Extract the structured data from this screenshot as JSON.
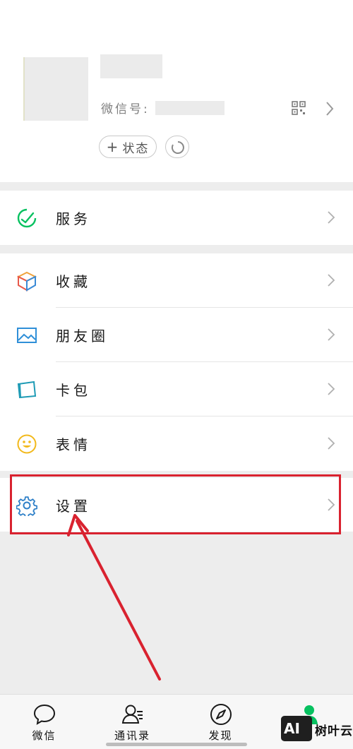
{
  "profile": {
    "wechat_id_label": "微信号:",
    "status_button_plus": "+",
    "status_button_label": "状态"
  },
  "menu": {
    "services": {
      "label": "服务",
      "icon": "services-icon"
    },
    "favorites": {
      "label": "收藏",
      "icon": "favorites-cube-icon"
    },
    "moments": {
      "label": "朋友圈",
      "icon": "moments-image-icon"
    },
    "cards": {
      "label": "卡包",
      "icon": "card-wallet-icon"
    },
    "stickers": {
      "label": "表情",
      "icon": "smiley-icon"
    },
    "settings": {
      "label": "设置",
      "icon": "gear-icon"
    }
  },
  "tabbar": {
    "chats": "微信",
    "contacts": "通讯录",
    "discover": "发现"
  },
  "watermark": {
    "badge": "AI",
    "text": "树叶云"
  },
  "colors": {
    "accent_green": "#07c160",
    "annotation_red": "#d9222f",
    "background": "#ededed"
  }
}
